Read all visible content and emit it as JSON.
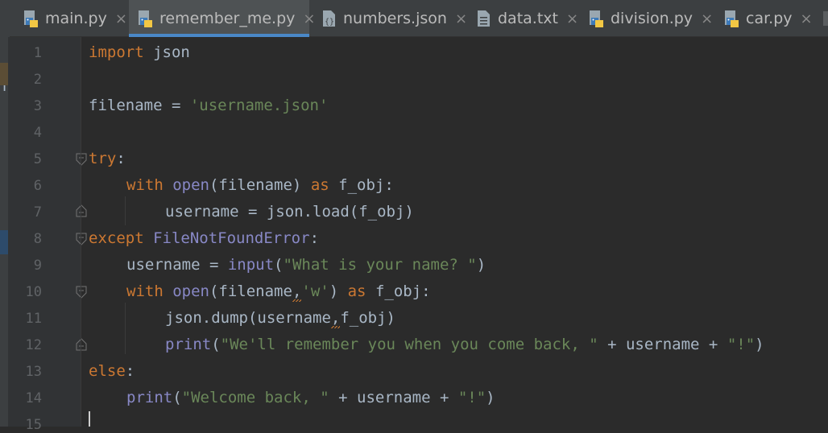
{
  "tabs": [
    {
      "label": "main.py",
      "icon": "python-file-icon",
      "active": false
    },
    {
      "label": "remember_me.py",
      "icon": "python-file-icon",
      "active": true
    },
    {
      "label": "numbers.json",
      "icon": "json-file-icon",
      "active": false
    },
    {
      "label": "data.txt",
      "icon": "text-file-icon",
      "active": false
    },
    {
      "label": "division.py",
      "icon": "python-file-icon",
      "active": false
    },
    {
      "label": "car.py",
      "icon": "python-file-icon",
      "active": false
    }
  ],
  "close_glyph": "×",
  "left_sliver_letter": "n",
  "line_numbers": [
    "1",
    "2",
    "3",
    "4",
    "5",
    "6",
    "7",
    "8",
    "9",
    "10",
    "11",
    "12",
    "13",
    "14",
    "15"
  ],
  "code": {
    "l1": {
      "kw": "import",
      "rest": " json"
    },
    "l3": {
      "a": "filename = ",
      "str": "'username.json'"
    },
    "l5": {
      "kw": "try",
      "rest": ":"
    },
    "l6": {
      "kw1": "with",
      "sp1": " ",
      "fn": "open",
      "mid": "(filename) ",
      "kw2": "as",
      "rest": " f_obj:"
    },
    "l7": {
      "text": "username = json.load(f_obj)"
    },
    "l8": {
      "kw": "except",
      "sp": " ",
      "fn": "FileNotFoundError",
      "rest": ":"
    },
    "l9": {
      "a": "username = ",
      "fn": "input",
      "b": "(",
      "str": "\"What is your name? \"",
      "c": ")"
    },
    "l10": {
      "kw1": "with",
      "sp1": " ",
      "fn": "open",
      "a": "(filename",
      "comma": ",",
      "str": "'w'",
      "b": ") ",
      "kw2": "as",
      "rest": " f_obj:"
    },
    "l11": {
      "a": "json.dump(username",
      "comma": ",",
      "b": "f_obj)"
    },
    "l12": {
      "fn": "print",
      "a": "(",
      "str": "\"We'll remember you when you come back, \"",
      "b": " + username + ",
      "str2": "\"!\"",
      "c": ")"
    },
    "l13": {
      "kw": "else",
      "rest": ":"
    },
    "l14": {
      "fn": "print",
      "a": "(",
      "str": "\"Welcome back, \"",
      "b": " + username + ",
      "str2": "\"!\"",
      "c": ")"
    }
  },
  "colors": {
    "keyword": "#cc7832",
    "string": "#6a8759",
    "builtin": "#8888c6",
    "text": "#a9b7c6",
    "accent": "#4a88c7"
  }
}
